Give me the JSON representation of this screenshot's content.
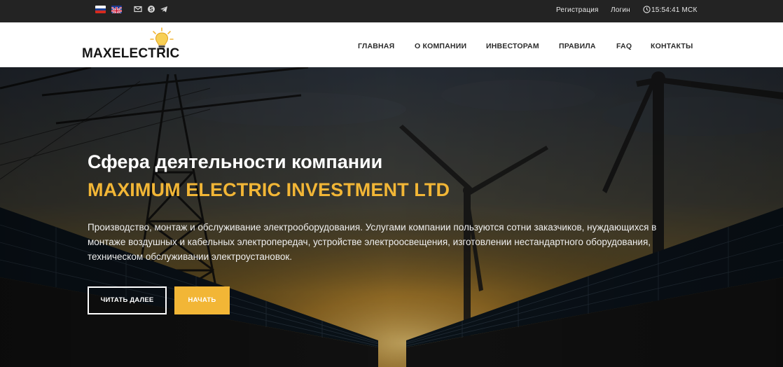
{
  "topbar": {
    "register_label": "Регистрация",
    "login_label": "Логин",
    "clock": "15:54:41 МСК"
  },
  "brand": {
    "logo_text": "MAXELECTRIC",
    "accent_color": "#f2b636"
  },
  "nav": {
    "items": [
      "ГЛАВНАЯ",
      "О КОМПАНИИ",
      "ИНВЕСТОРАМ",
      "ПРАВИЛА",
      "FAQ",
      "КОНТАКТЫ"
    ]
  },
  "hero": {
    "headline": "Сфера деятельности компании",
    "company": "MAXIMUM ELECTRIC INVESTMENT LTD",
    "description": "Производство, монтаж и обслуживание электрооборудования. Услугами компании пользуются сотни заказчиков, нуждающихся в монтаже воздушных и кабельных электропередач, устройстве электроосвещения, изготовлении нестандартного оборудования, техническом обслуживании электроустановок.",
    "read_more_label": "ЧИТАТЬ ДАЛЕЕ",
    "start_label": "НАЧАТЬ"
  },
  "icons": [
    "flag-ru-icon",
    "flag-en-icon",
    "mail-icon",
    "skype-icon",
    "telegram-icon",
    "clock-icon",
    "bulb-icon"
  ]
}
